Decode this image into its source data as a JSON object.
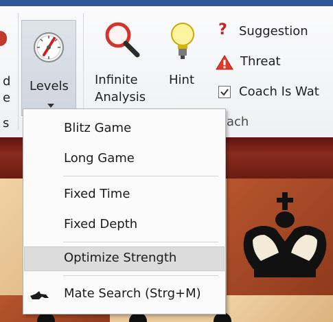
{
  "ribbon": {
    "partial_left_top": "d",
    "partial_left_mid": "e",
    "partial_left_bottom": "s",
    "levels_label": "Levels",
    "infinite_analysis_line1": "Infinite",
    "infinite_analysis_line2": "Analysis",
    "hint_label": "Hint",
    "suggestion_label": "Suggestion",
    "threat_label": "Threat",
    "coach_checkbox_label": "Coach Is Wat",
    "group_label_partial": "ach"
  },
  "menu": {
    "items": [
      {
        "label": "Blitz Game"
      },
      {
        "label": "Long Game"
      },
      {
        "label": "Fixed Time"
      },
      {
        "label": "Fixed Depth"
      },
      {
        "label": "Optimize Strength"
      },
      {
        "label": "Mate Search (Strg+M)"
      }
    ],
    "highlighted_item": "Optimize Strength"
  },
  "icons": {
    "levels": "levels-gauge-icon",
    "analysis": "magnifier-icon",
    "hint": "lightbulb-icon",
    "suggestion": "question-mark-icon",
    "threat": "warning-triangle-icon",
    "coach": "checkbox-checked-icon",
    "mate": "chess-piece-icon"
  },
  "colors": {
    "titlebar": "#2f5597",
    "menu_highlight": "#dcdcdc",
    "board_dark": "#a04a25",
    "board_light": "#e9c89a"
  }
}
